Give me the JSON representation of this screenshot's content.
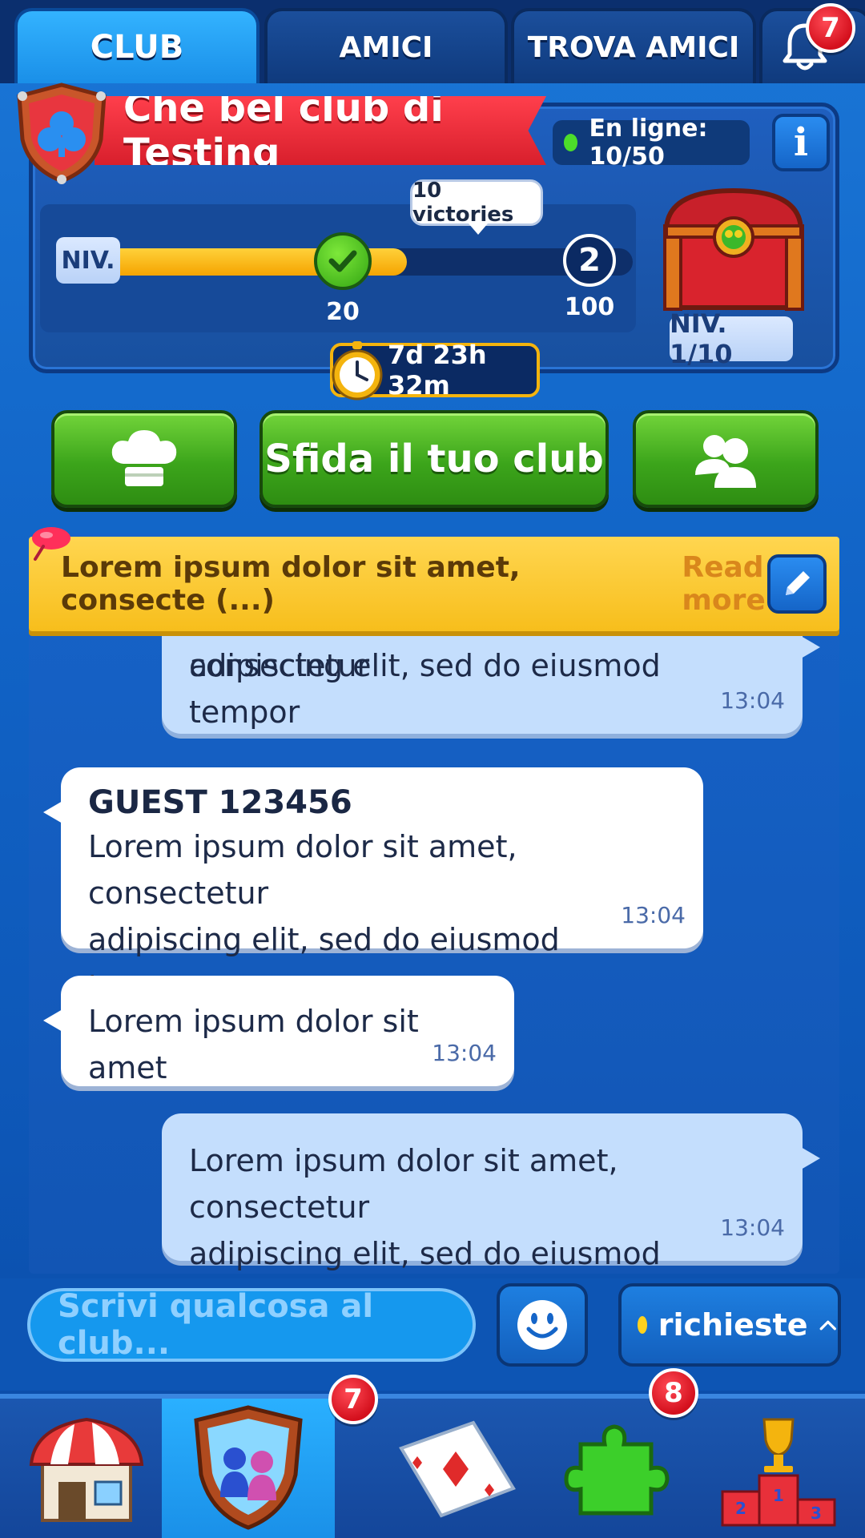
{
  "tabs": {
    "club": "CLUB",
    "amici": "AMICI",
    "trova": "TROVA AMICI",
    "notifications_count": "7"
  },
  "club": {
    "name": "Che bel club di Testing",
    "online": "En ligne: 10/50",
    "info": "i",
    "level_label": "NIV.",
    "progress_fraction": 0.56,
    "milestone_value": "20",
    "next_level": "2",
    "max_value": "100",
    "victories": "10 victories",
    "chest_level": "NIV. 1/10",
    "timer": "7d 23h 32m"
  },
  "actions": {
    "sfida": "Sfida il tuo club"
  },
  "pinned": {
    "text": "Lorem ipsum dolor sit amet, consecte (...)",
    "read_more": "Read more"
  },
  "messages": [
    {
      "line1": "Lorem ipsum dolor sit amet, consectetur",
      "line2": "adipiscing elit, sed do eiusmod tempor",
      "time": "13:04"
    },
    {
      "author": "GUEST 123456",
      "line1": "Lorem ipsum dolor sit amet, consectetur",
      "line2": "adipiscing elit, sed do eiusmod tempor",
      "time": "13:04"
    },
    {
      "line1": "Lorem ipsum dolor sit amet",
      "time": "13:04"
    },
    {
      "line1": "Lorem ipsum dolor sit amet, consectetur",
      "line2": "adipiscing elit, sed do eiusmod tempor",
      "time": "13:04"
    }
  ],
  "input": {
    "placeholder": "Scrivi qualcosa al club..."
  },
  "requests": {
    "label": "richieste"
  },
  "bottom_nav": {
    "club_badge": "7",
    "puzzle_badge": "8",
    "icons": [
      "shop-icon",
      "club-icon",
      "cards-icon",
      "puzzle-icon",
      "podium-icon"
    ]
  },
  "colors": {
    "accent_green": "#3ca51b",
    "ribbon_red": "#d81f2c",
    "note_yellow": "#f7be1c",
    "badge_red": "#d4101d"
  }
}
